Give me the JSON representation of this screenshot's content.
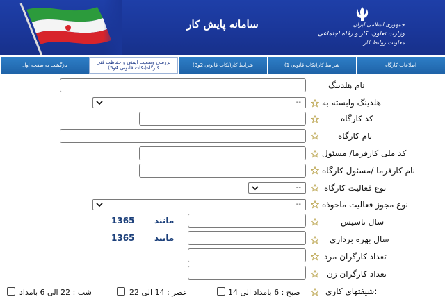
{
  "header": {
    "title": "سامانه پایش کار",
    "org_line1": "جمهوری اسلامی ایران",
    "org_line2": "وزارت تعاون، کار و رفاه اجتماعی",
    "org_line3": "معاونت روابط کار",
    "icons": [
      "iran-flag-icon",
      "iran-emblem-icon"
    ]
  },
  "tabs": [
    {
      "label": "اطلاعات کارگاه"
    },
    {
      "label": "شرایط کار(نکات قانونی 1)"
    },
    {
      "label": "شرایط کار(نکات قانونی 2و3)"
    },
    {
      "label": "بررسی وضعیت ایمنی و حفاظت فنی کارگاه(نکات قانونی 4و5)"
    },
    {
      "label": "بازگشت به صفحه اول"
    }
  ],
  "form": {
    "holding_name_label": "نام هلدینگ",
    "holding_affiliated_label": "هلدینگ وابسته به",
    "holding_affiliated_value": "--",
    "workshop_code_label": "کد کارگاه",
    "workshop_name_label": "نام کارگاه",
    "employer_national_code_label": "کد ملی کارفرما/ مسئول",
    "employer_name_label": "نام کارفرما /مسئول کارگاه",
    "activity_type_label": "نوع فعالیت کارگاه",
    "activity_type_value": "--",
    "permit_type_label": "نوع مجوز فعالیت ماخوذه",
    "permit_type_value": "--",
    "founding_year_label": "سال تاسیس",
    "founding_year_hint_word": "مانند",
    "founding_year_hint_num": "1365",
    "operation_year_label": "سال بهره برداری",
    "operation_year_hint_word": "مانند",
    "operation_year_hint_num": "1365",
    "male_workers_label": "تعداد کارگران مرد",
    "female_workers_label": "تعداد کارگران زن",
    "shifts_label": "شیفتهای کاری:",
    "shift_morning": "صبح : 6 بامداد الی 14",
    "shift_evening": "عصر : 14 الی 22",
    "shift_night": "شب : 22 الی 6 بامداد"
  },
  "colors": {
    "header_blue": "#1a3698",
    "tab_blue": "#2670b8",
    "hint_blue": "#1b3f7a",
    "star": "#c9b45a"
  }
}
